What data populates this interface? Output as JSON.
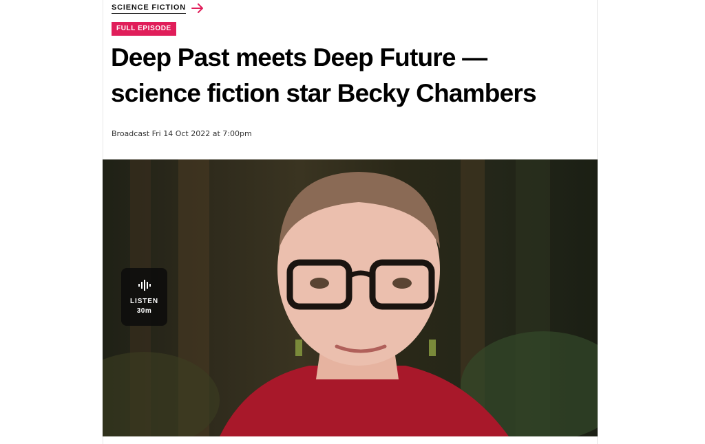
{
  "program": {
    "label": "SCIENCE FICTION",
    "arrow_icon": "arrow-right-icon",
    "accent": "#e01e5a"
  },
  "badge": {
    "label": "FULL EPISODE",
    "color": "#e01e5a"
  },
  "headline": {
    "line1": "Deep Past meets Deep Future —",
    "line2": "science fiction star Becky Chambers"
  },
  "broadcast": {
    "text": "Broadcast Fri 14 Oct 2022 at 7:00pm"
  },
  "hero": {
    "subject": "portrait-photo"
  },
  "listen": {
    "icon": "waveform-icon",
    "label": "LISTEN",
    "duration": "30m"
  }
}
